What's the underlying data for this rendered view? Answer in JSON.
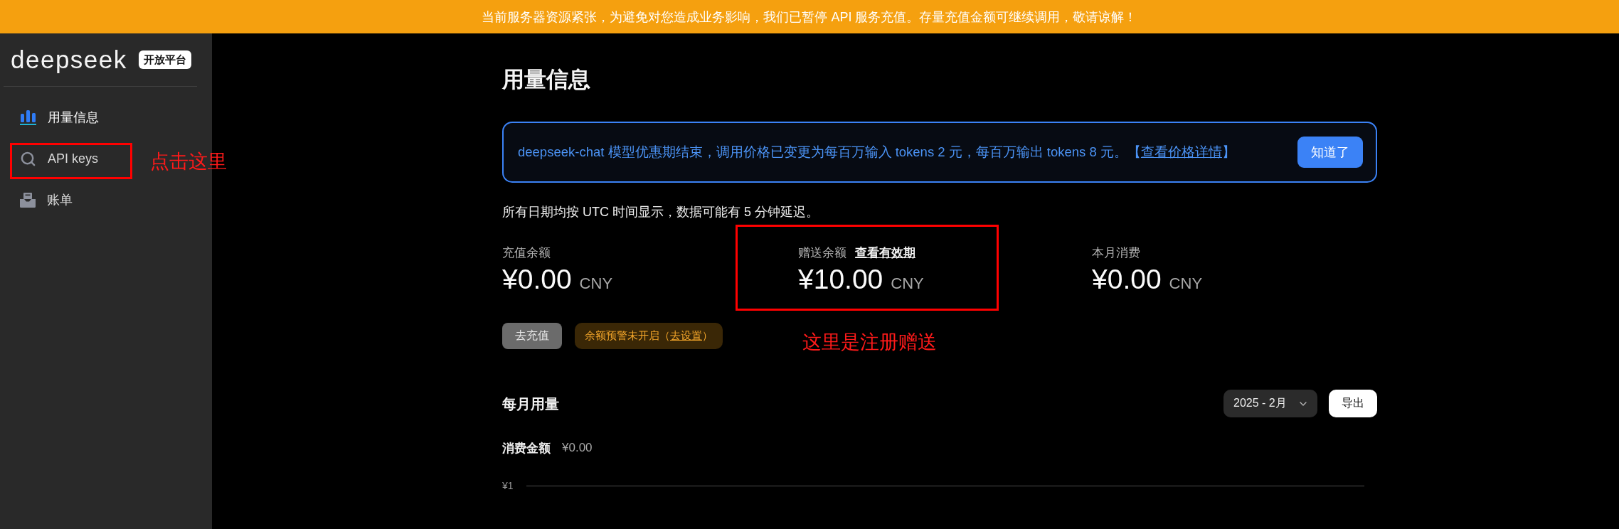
{
  "banner": {
    "text": "当前服务器资源紧张，为避免对您造成业务影响，我们已暂停 API 服务充值。存量充值金额可继续调用，敬请谅解！"
  },
  "sidebar": {
    "logo": "deepseek",
    "badge": "开放平台",
    "items": [
      {
        "label": "用量信息",
        "selected": true
      },
      {
        "label": "API keys",
        "selected": false,
        "annotation": "点击这里"
      },
      {
        "label": "账单",
        "selected": false
      }
    ]
  },
  "main": {
    "title": "用量信息",
    "notice": {
      "text_before": "deepseek-chat 模型优惠期结束，调用价格已变更为每百万输入 tokens 2 元，每百万输出 tokens 8 元。【",
      "link": "查看价格详情",
      "text_after": "】",
      "button": "知道了"
    },
    "timezone_note": "所有日期均按 UTC 时间显示，数据可能有 5 分钟延迟。",
    "balances": [
      {
        "label": "充值余额",
        "amount": "¥0.00",
        "currency": "CNY"
      },
      {
        "label": "赠送余额",
        "link": "查看有效期",
        "amount": "¥10.00",
        "currency": "CNY",
        "annotation": "这里是注册赠送"
      },
      {
        "label": "本月消费",
        "amount": "¥0.00",
        "currency": "CNY"
      }
    ],
    "recharge_button": "去充值",
    "alert": {
      "text_before": "余额预警未开启（",
      "link": "去设置",
      "text_after": "）"
    },
    "monthly_usage": {
      "title": "每月用量",
      "month_select": "2025 - 2月",
      "export_button": "导出",
      "spend_label": "消费金额",
      "spend_value": "¥0.00",
      "y_tick": "¥1"
    }
  }
}
